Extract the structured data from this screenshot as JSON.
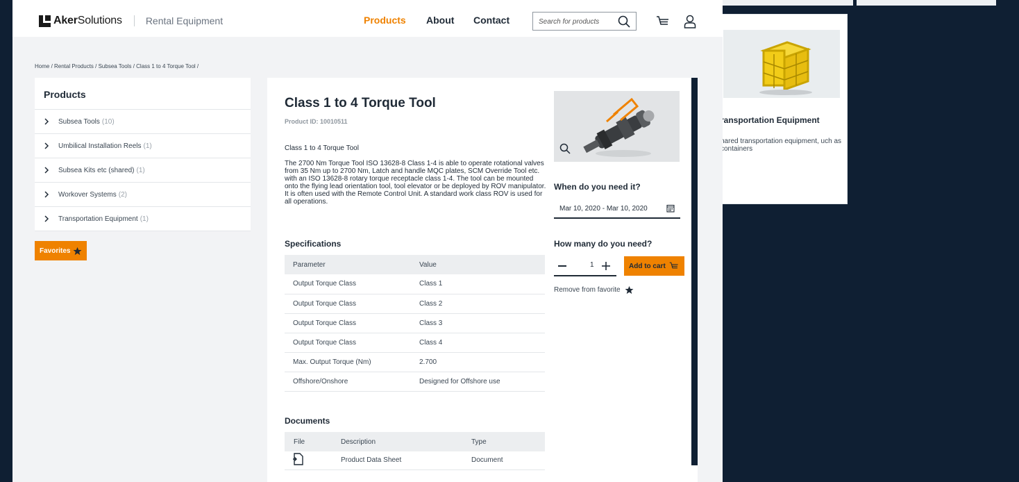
{
  "header": {
    "logo_bold": "Aker",
    "logo_regular": "Solutions",
    "logo_sub": "Rental Equipment",
    "nav": [
      {
        "label": "Products",
        "active": true
      },
      {
        "label": "About",
        "active": false
      },
      {
        "label": "Contact",
        "active": false
      }
    ],
    "search_placeholder": "Search for products",
    "icons": [
      "search-icon",
      "cart-icon",
      "user-icon"
    ]
  },
  "breadcrumb": "Home / Rental Products / Subsea Tools / Class 1 to 4 Torque Tool /",
  "sidebar": {
    "title": "Products",
    "items": [
      {
        "label": "Subsea Tools",
        "count": "(10)"
      },
      {
        "label": "Umbilical Installation Reels",
        "count": "(1)"
      },
      {
        "label": "Subsea Kits etc (shared)",
        "count": "(1)"
      },
      {
        "label": "Workover Systems",
        "count": "(2)"
      },
      {
        "label": "Transportation Equipment",
        "count": "(1)"
      }
    ],
    "favorites_label": "Favorites"
  },
  "product": {
    "title": "Class 1 to 4 Torque Tool",
    "id": "Product ID: 10010511",
    "short": "Class 1 to 4 Torque Tool",
    "description": "The 2700 Nm Torque Tool ISO 13628-8 Class 1-4 is able to operate rotational valves from 35 Nm up to 2700 Nm, Latch and handle MQC plates, SCM Override Tool etc. with an ISO 13628-8 rotary torque receptacle class 1-4. The tool can be mounted onto the flying lead orientation tool, tool elevator or be deployed by ROV manipulator. It is often used with the Remote Control Unit. A standard work class ROV is used for all operations."
  },
  "specifications": {
    "title": "Specifications",
    "headers": [
      "Parameter",
      "Value"
    ],
    "rows": [
      [
        "Output Torque Class",
        "Class 1"
      ],
      [
        "Output Torque Class",
        "Class 2"
      ],
      [
        "Output Torque Class",
        "Class 3"
      ],
      [
        "Output Torque Class",
        "Class 4"
      ],
      [
        "Max. Output Torque (Nm)",
        "2.700"
      ],
      [
        "Offshore/Onshore",
        "Designed for Offshore use"
      ]
    ]
  },
  "documents": {
    "title": "Documents",
    "headers": [
      "File",
      "Description",
      "Type"
    ],
    "rows": [
      {
        "icon": "pdf-icon",
        "description": "Product Data Sheet",
        "type": "Document"
      }
    ]
  },
  "order": {
    "when_label": "When do you need it?",
    "date_range": "Mar 10, 2020 - Mar 10, 2020",
    "qty_label": "How many do you need?",
    "quantity": "1",
    "add_to_cart": "Add to cart",
    "remove_favorite": "Remove from favorite"
  },
  "background_card": {
    "title": "ransportation Equipment",
    "desc": "hared transportation equipment, uch as containers"
  },
  "colors": {
    "accent": "#ef8200",
    "navy": "#0f1f33",
    "text": "#1f2a36"
  }
}
